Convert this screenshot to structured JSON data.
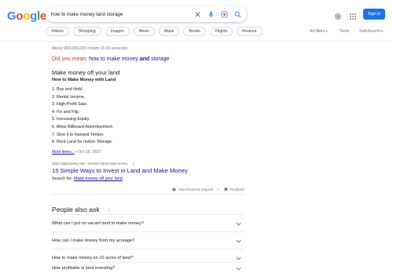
{
  "logo": {
    "letters": [
      "G",
      "o",
      "o",
      "g",
      "l",
      "e"
    ]
  },
  "search": {
    "query": "how to make money land storage"
  },
  "header": {
    "sign_in": "Sign in"
  },
  "tabs": [
    "Videos",
    "Shopping",
    "Images",
    "News",
    "Maps",
    "Books",
    "Flights",
    "Finance"
  ],
  "tools": {
    "all_filters": "All filters",
    "tools": "Tools",
    "safesearch": "SafeSearch"
  },
  "results_stats": "About 993,000,000 results (0.43 seconds)",
  "did_you_mean": {
    "label": "Did you mean:",
    "prefix": "how to make money ",
    "emph": "and",
    "suffix": " storage"
  },
  "snippet": {
    "title": "Make money off your land",
    "subtitle": "How to Make Money with Land",
    "items": [
      "1. Buy and Hold.",
      "2. Rental Income.",
      "3. High-Profit Sale.",
      "4. Fix and Flip.",
      "5. Increasing Equity.",
      "6. Allow Billboard Advertisement.",
      "7. Give it to Harvest Timber.",
      "8. Rent Land for Indoor Storage."
    ],
    "more_items": "More items...",
    "date": "• Oct 18, 2022"
  },
  "result": {
    "url": "https://aplproperty.com › invest-in-land-make-money",
    "title": "15 Simple Ways to Invest in Land and Make Money",
    "search_for_label": "Search for:",
    "search_for_link": "Make money off your land"
  },
  "feedback": {
    "about": "About featured snippets",
    "sep": "•",
    "feedback": "Feedback"
  },
  "people_also_ask": {
    "title": "People also ask",
    "questions": [
      "What can I put on vacant land to make money?",
      "How can I make money from my acreage?",
      "How to make money on 10 acres of land?",
      "How profitable is land investing?"
    ]
  },
  "colors": {
    "accent": "#1a73e8",
    "link": "#1a0dab",
    "did_you_mean": "#d93025"
  }
}
